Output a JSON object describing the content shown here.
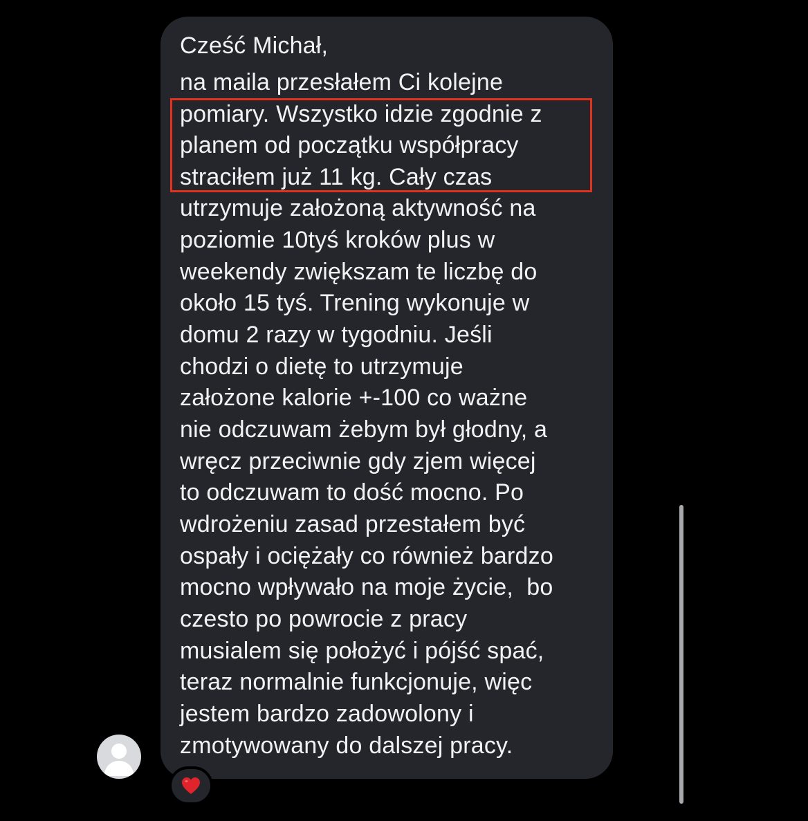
{
  "message": {
    "lines": [
      "Cześć Michał,",
      "na maila przesłałem Ci kolejne",
      "pomiary. Wszystko idzie zgodnie z",
      "planem od początku współpracy",
      "straciłem już 11 kg. Cały czas",
      "utrzymuje założoną aktywność na",
      "poziomie 10tyś kroków plus w",
      "weekendy zwiększam te liczbę do",
      "około 15 tyś. Trening wykonuje w",
      "domu 2 razy w tygodniu. Jeśli",
      "chodzi o dietę to utrzymuje",
      "założone kalorie +-100 co ważne",
      "nie odczuwam żebym był głodny, a",
      "wręcz przeciwnie gdy zjem więcej",
      "to odczuwam to dość mocno. Po",
      "wdrożeniu zasad przestałem być",
      "ospały i ociężały co również bardzo",
      "mocno wpływało na moje życie,  bo",
      "czesto po powrocie z pracy",
      "musialem się położyć i pójść spać,",
      "teraz normalnie funkcjonuje, więc",
      "jestem bardzo zadowolony i",
      "zmotywowany do dalszej pracy."
    ]
  },
  "reaction": {
    "icon": "heart-icon",
    "color": "#e0242c"
  },
  "avatar": {
    "icon": "default-user-avatar-icon"
  },
  "highlight": {
    "color": "#e0321e"
  },
  "colors": {
    "background": "#000000",
    "bubble": "#24262c",
    "text": "#f2f2f4"
  }
}
